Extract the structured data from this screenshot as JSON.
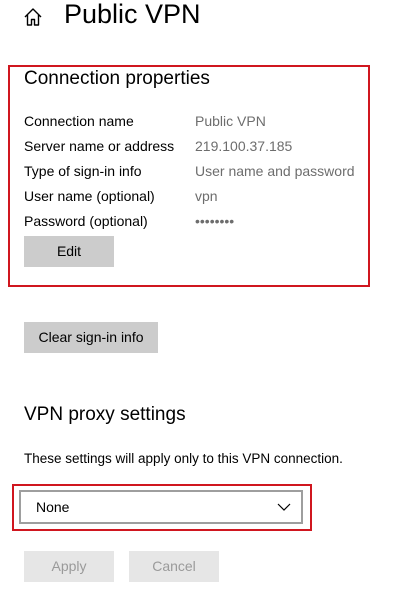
{
  "header": {
    "title": "Public VPN",
    "home_icon": "home-icon"
  },
  "connection_properties": {
    "heading": "Connection properties",
    "rows": [
      {
        "label": "Connection name",
        "value": "Public VPN"
      },
      {
        "label": "Server name or address",
        "value": "219.100.37.185"
      },
      {
        "label": "Type of sign-in info",
        "value": "User name and password"
      },
      {
        "label": "User name (optional)",
        "value": "vpn"
      },
      {
        "label": "Password (optional)",
        "value": "••••••••"
      }
    ],
    "edit_label": "Edit"
  },
  "clear_signin_label": "Clear sign-in info",
  "proxy": {
    "heading": "VPN proxy settings",
    "description": "These settings will apply only to this VPN connection.",
    "selected": "None",
    "apply_label": "Apply",
    "cancel_label": "Cancel"
  },
  "colors": {
    "highlight": "#d0161f",
    "button": "#cccccc",
    "button_disabled": "#e6e6e6",
    "value_text": "#6d6d6d"
  }
}
